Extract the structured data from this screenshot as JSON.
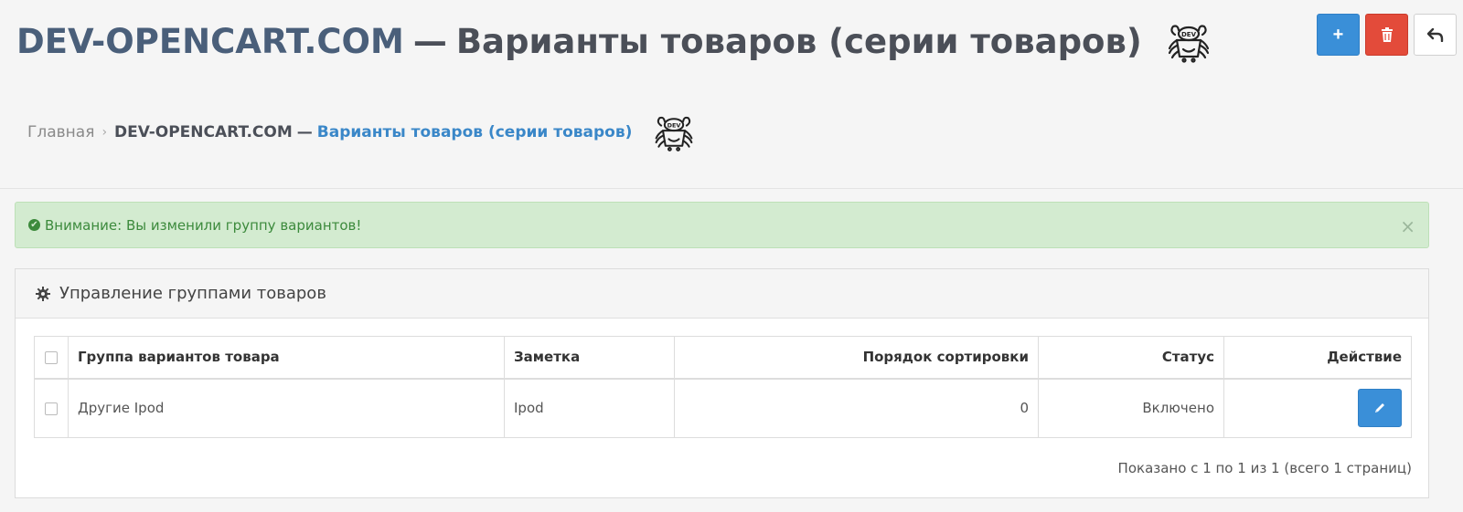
{
  "header": {
    "brand": "DEV-OPENCART.COM",
    "dash": "—",
    "title": "Варианты товаров (серии товаров)",
    "logo_text": "DEV"
  },
  "toolbar": {
    "add_icon": "+",
    "delete_icon": "🗑",
    "back_icon": "↶"
  },
  "breadcrumb": {
    "home": "Главная",
    "separator": "›",
    "brand": "DEV-OPENCART.COM",
    "dash": "—",
    "current": "Варианты товаров (серии товаров)"
  },
  "alert": {
    "icon": "✔",
    "message": "Внимание: Вы изменили группу вариантов!",
    "close": "×"
  },
  "panel": {
    "title": "Управление группами товаров",
    "columns": {
      "name": "Группа вариантов товара",
      "note": "Заметка",
      "sort": "Порядок сортировки",
      "status": "Статус",
      "action": "Действие"
    },
    "rows": [
      {
        "name": "Другие Ipod",
        "note": "Ipod",
        "sort": "0",
        "status": "Включено"
      }
    ],
    "pagination_info": "Показано с 1 по 1 из 1 (всего 1 страниц)"
  },
  "colors": {
    "primary": "#3a8fd8",
    "danger": "#e34b3a",
    "success_bg": "#d3ebd0",
    "success_text": "#3c8a3c",
    "link": "#3a87c8"
  }
}
